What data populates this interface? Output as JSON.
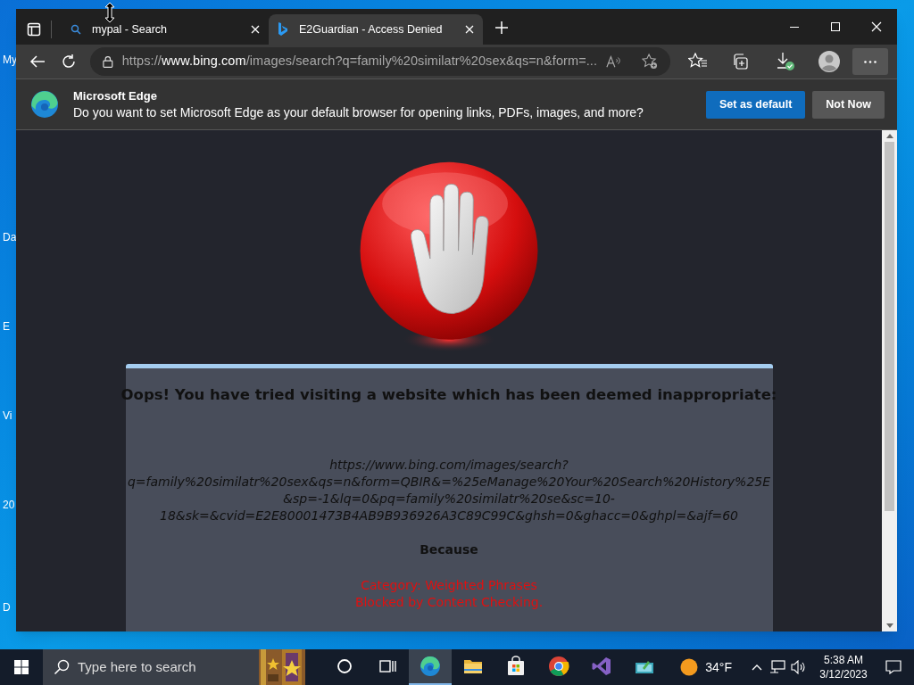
{
  "desktop": {
    "icon_labels": [
      "My",
      "Da",
      "E",
      "Vi",
      "20",
      "D"
    ]
  },
  "browser": {
    "tabs": [
      {
        "title": "mypal - Search",
        "selected": false,
        "kind": "search"
      },
      {
        "title": "E2Guardian - Access Denied",
        "selected": true,
        "kind": "bing"
      }
    ],
    "address": {
      "scheme": "https://",
      "host": "www.bing.com",
      "path": "/images/search?q=family%20similatr%20sex&qs=n&form=..."
    },
    "infobar": {
      "title": "Microsoft Edge",
      "message": "Do you want to set Microsoft Edge as your default browser for opening links, PDFs, images, and more?",
      "buttons": [
        {
          "label": "Set as default",
          "kind": "primary"
        },
        {
          "label": "Not Now",
          "kind": "secondary"
        }
      ]
    }
  },
  "page": {
    "heading": "Oops! You have tried visiting a website which has been deemed inappropriate:",
    "blocked_url": "https://www.bing.com/images/search?q=family%20similatr%20sex&qs=n&form=QBIR&=%25eManage%20Your%20Search%20History%25E&sp=-1&lq=0&pq=family%20similatr%20se&sc=10-18&sk=&cvid=E2E80001473B4AB9B936926A3C89C99C&ghsh=0&ghacc=0&ghpl=&ajf=60",
    "because": "Because",
    "reasons": [
      "Category: Weighted Phrases",
      "Blocked by Content Checking."
    ]
  },
  "taskbar": {
    "search_placeholder": "Type here to search",
    "apps": [
      {
        "kind": "cortana",
        "selected": false
      },
      {
        "kind": "taskview",
        "selected": false
      },
      {
        "kind": "edge",
        "selected": true
      },
      {
        "kind": "folder",
        "selected": false
      },
      {
        "kind": "store",
        "selected": false
      },
      {
        "kind": "chrome",
        "selected": false
      },
      {
        "kind": "vs",
        "selected": false
      },
      {
        "kind": "app",
        "selected": false
      }
    ],
    "weather": "34°F",
    "time": "5:38 AM",
    "date": "3/12/2023"
  }
}
